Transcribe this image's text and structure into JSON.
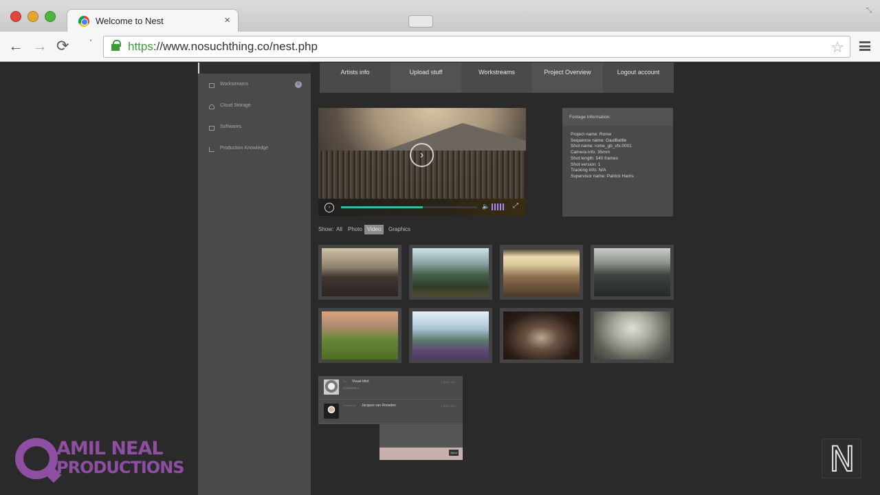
{
  "browser": {
    "tab_title": "Welcome to Nest",
    "tab_close": "×",
    "url_scheme": "https",
    "url_rest": "://www.nosuchthing.co/nest.php",
    "omni_tick": "'",
    "back": "←",
    "forward": "→",
    "reload": "⟳",
    "star": "☆",
    "resize": "⤡"
  },
  "sidebar": {
    "items": [
      {
        "label": "Workstreams",
        "icon": "workstreams-icon"
      },
      {
        "label": "Cloud Storage",
        "icon": "cloud-icon"
      },
      {
        "label": "Softwares",
        "icon": "softwares-icon"
      },
      {
        "label": "Production Knowledge",
        "icon": "chart-icon"
      }
    ],
    "badge": "0"
  },
  "topnav": [
    "Artists info",
    "Upload stuff",
    "Workstreams",
    "Project Overview",
    "Logout account"
  ],
  "player": {
    "play_glyph": "›",
    "small_play_glyph": "›",
    "progress": 0.6,
    "volume_glyph": "🔈",
    "fullscreen_glyph": "⤢",
    "accent": "#3bb7a6",
    "volume_color": "#a48cf0"
  },
  "footage": {
    "heading": "Footage Information:",
    "lines": [
      "Project name: Rome",
      "Sequence name: GaulBattle",
      "Shot name: rome_gb_vfx.0001",
      "Camera info: 35mm",
      "Shot length: 540 frames",
      "Shot version: 1",
      "Tracking info: N/A",
      "Supervisor name: Patrick Harris"
    ]
  },
  "filter": {
    "label": "Show:",
    "options": [
      "All",
      "Photo",
      "Video",
      "Graphics"
    ],
    "active": "Video"
  },
  "comments": [
    {
      "meta": "By:",
      "name": "Visual Idiot",
      "body": "Comment 1",
      "time": "2 days ago"
    },
    {
      "meta": "Posted by:",
      "name": "Jacques van Rooeden",
      "body": "",
      "time": "3 days ago"
    }
  ],
  "reply": {
    "send_label": "Send"
  },
  "watermark": {
    "line1": "AMIL NEAL",
    "line2": "PRODUCTIONS",
    "badge": "N"
  }
}
